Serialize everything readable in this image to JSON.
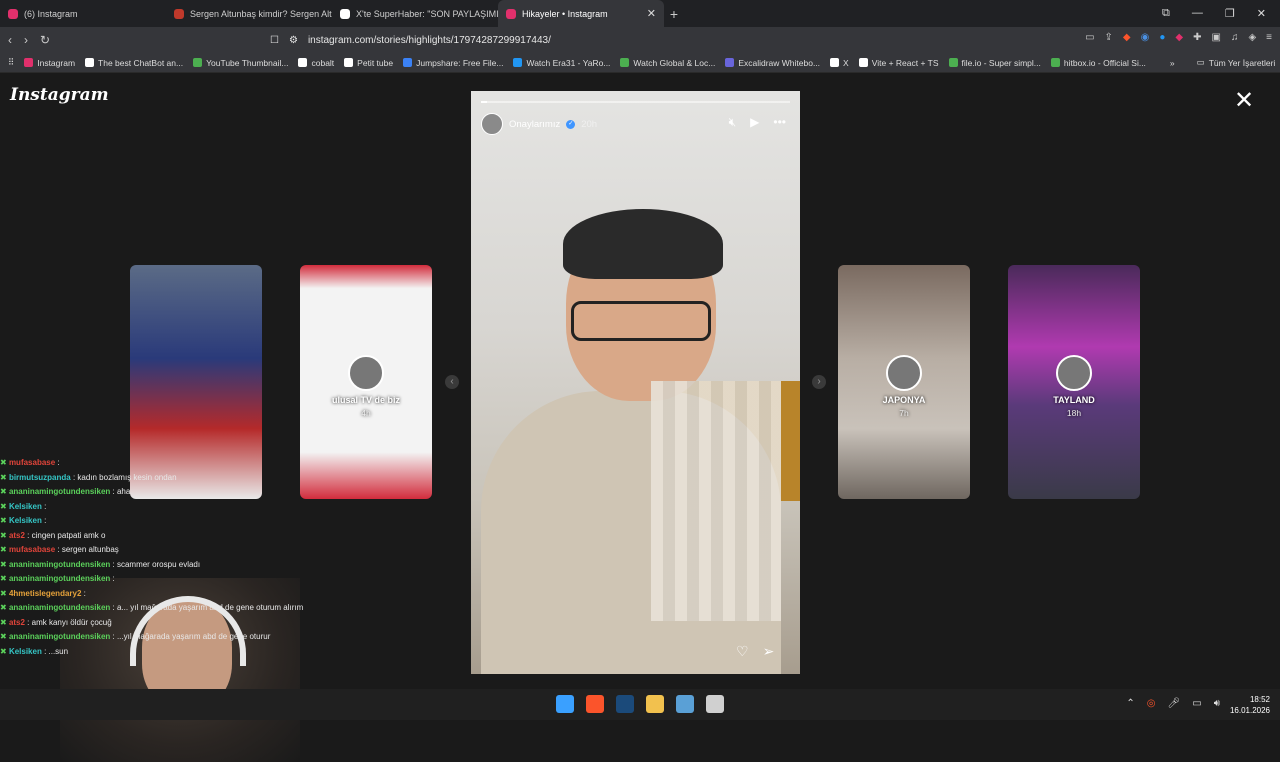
{
  "browser": {
    "tabs": [
      {
        "title": "(6) Instagram",
        "color": "#e1306c"
      },
      {
        "title": "Sergen Altunbaş kimdir? Sergen Altu",
        "color": "#c0392b"
      },
      {
        "title": "X'te SuperHaber: \"SON PAYLAŞIMINI",
        "color": "#ffffff"
      },
      {
        "title": "Hikayeler • Instagram",
        "color": "#e1306c",
        "active": true
      }
    ],
    "new_tab": "+",
    "url": "instagram.com/stories/highlights/17974287299917443/",
    "bookmarks": [
      {
        "label": "Instagram",
        "color": "#e1306c"
      },
      {
        "label": "The best ChatBot an...",
        "color": "#ffffff"
      },
      {
        "label": "YouTube Thumbnail...",
        "color": "#4caf50"
      },
      {
        "label": "cobalt",
        "color": "#ffffff"
      },
      {
        "label": "Petit tube",
        "color": "#ffffff"
      },
      {
        "label": "Jumpshare: Free File...",
        "color": "#3b82f6"
      },
      {
        "label": "Watch Era31 - YaRo...",
        "color": "#2196f3"
      },
      {
        "label": "Watch Global & Loc...",
        "color": "#4caf50"
      },
      {
        "label": "Excalidraw Whitebo...",
        "color": "#6965db"
      },
      {
        "label": "X",
        "color": "#ffffff"
      },
      {
        "label": "Vite + React + TS",
        "color": "#ffffff"
      },
      {
        "label": "file.io - Super simpl...",
        "color": "#4caf50"
      },
      {
        "label": "hitbox.io - Official Si...",
        "color": "#4caf50"
      }
    ],
    "bookmarks_more": "»",
    "all_bookmarks": "Tüm Yer İşaretleri"
  },
  "instagram": {
    "logo": "Instagram",
    "close": "✕",
    "story": {
      "username": "Onaylarımız",
      "time": "20h",
      "progress": 0.02,
      "like_icon": "♡",
      "share_icon": "➢"
    },
    "left_thumbs": [
      {
        "label": "",
        "time": "",
        "bg": "linear-gradient(180deg,#5b6b86 0%,#2a3a7a 40%,#b52a2a 70%,#e9e9e9 100%)"
      },
      {
        "label": "ulusal TV de biz",
        "time": "4h",
        "bg": "linear-gradient(180deg,#d22c3c 0%,#f3f3f3 10%,#f3f3f3 80%,#d22c3c 100%)"
      }
    ],
    "right_thumbs": [
      {
        "label": "JAPONYA",
        "time": "7h",
        "bg": "linear-gradient(180deg,#7a6a60 0%,#b8aea4 40%,#c9c2ba 70%,#6f6760 100%)"
      },
      {
        "label": "TAYLAND",
        "time": "18h",
        "bg": "linear-gradient(180deg,#4a2a5a 0%,#b03ab0 35%,#5a3a7a 60%,#3a3a48 100%)"
      }
    ],
    "arrow_left": "‹",
    "arrow_right": "›"
  },
  "chat": [
    {
      "user": "mufasabase",
      "msg": ":",
      "color": "#e0443a"
    },
    {
      "user": "birmutsuzpanda",
      "msg": ": kadın bozlamış kesin ondan",
      "color": "#35c6c6"
    },
    {
      "user": "ananinamingotundensiken",
      "msg": ": aha",
      "color": "#5bd15b"
    },
    {
      "user": "Kelsiken",
      "msg": ":",
      "color": "#35c6c6"
    },
    {
      "user": "Kelsiken",
      "msg": ":",
      "color": "#35c6c6"
    },
    {
      "user": "ats2",
      "msg": ": cingen patpati amk o",
      "color": "#e0443a"
    },
    {
      "user": "mufasabase",
      "msg": ": sergen altunbaş",
      "color": "#e0443a"
    },
    {
      "user": "ananinamingotundensiken",
      "msg": ": scammer orospu evladı",
      "color": "#5bd15b"
    },
    {
      "user": "ananinamingotundensiken",
      "msg": ":",
      "color": "#5bd15b"
    },
    {
      "user": "4hmetislegendary2",
      "msg": ":",
      "color": "#e5a23a"
    },
    {
      "user": "ananinamingotundensiken",
      "msg": ": a... yıl mağarada yaşarım abd de gene oturum alırım",
      "color": "#5bd15b"
    },
    {
      "user": "ats2",
      "msg": ": amk kanyı öldür çocuğ",
      "color": "#e0443a"
    },
    {
      "user": "ananinamingotundensiken",
      "msg": ": ...yıl mağarada yaşarım abd de gene oturur",
      "color": "#5bd15b"
    },
    {
      "user": "Kelsiken",
      "msg": ": ...sun",
      "color": "#35c6c6"
    }
  ],
  "taskbar": {
    "apps": [
      {
        "name": "windows-start",
        "color": "#3aa0ff"
      },
      {
        "name": "brave",
        "color": "#fb542b"
      },
      {
        "name": "steam",
        "color": "#1b4a7a"
      },
      {
        "name": "file-explorer",
        "color": "#f2c14e"
      },
      {
        "name": "screen-app",
        "color": "#5aa0d6"
      },
      {
        "name": "stream-app",
        "color": "#d0d0d0"
      }
    ],
    "time": "18:52",
    "date": "16.01.2026"
  }
}
